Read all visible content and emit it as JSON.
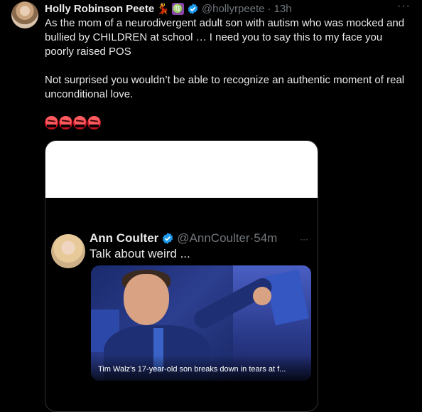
{
  "tweet": {
    "author_name": "Holly Robinson Peete",
    "author_emoji_dancer": "💃",
    "author_emoji_virgo": "♍",
    "handle": "@hollyrpeete",
    "separator": "·",
    "time": "13h",
    "more": "···",
    "paragraphs": [
      "As the mom of a neurodivergent adult son with autism who was mocked and bullied by CHILDREN at school … I need you to say this to my face you poorly raised POS",
      "Not surprised you wouldn’t be able to recognize an authentic moment of real unconditional love."
    ],
    "emojis": [
      "rage-face",
      "rage-face",
      "rage-face",
      "rage-face"
    ]
  },
  "quoted": {
    "author_name": "Ann Coulter",
    "handle": "@AnnCoulter",
    "separator": "·",
    "time": "54m",
    "more": "···",
    "text": "Talk about weird ...",
    "image_caption": "Tim Walz’s 17-year-old son breaks down in tears at f..."
  },
  "colors": {
    "background": "#000000",
    "text": "#e7e9ea",
    "muted": "#71767b",
    "verified": "#1d9bf0"
  }
}
